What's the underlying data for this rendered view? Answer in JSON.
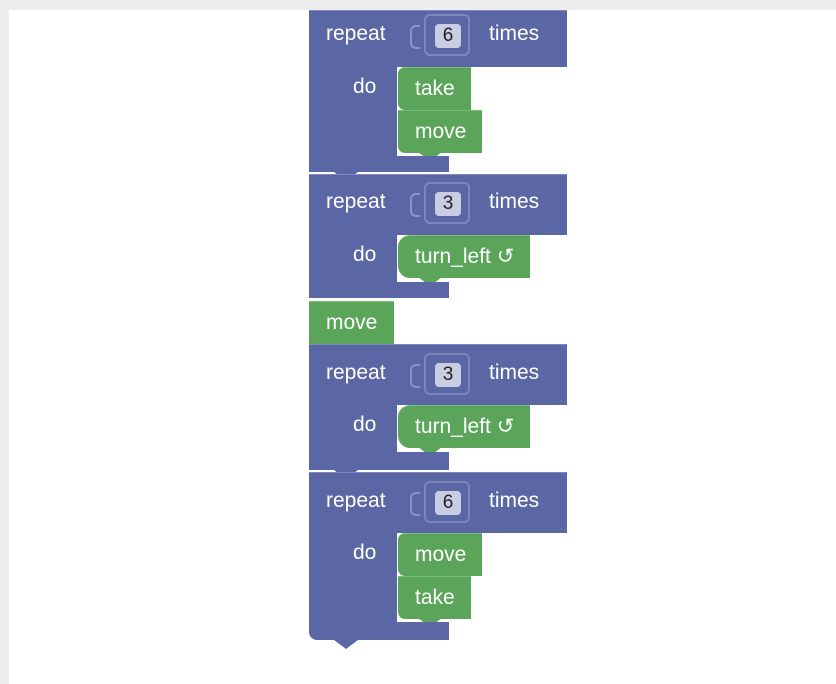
{
  "workspace": {
    "blocks": [
      {
        "type": "repeat",
        "keyword": "repeat",
        "count": "6",
        "suffix": "times",
        "do_label": "do",
        "body": [
          "take",
          "move"
        ]
      },
      {
        "type": "repeat",
        "keyword": "repeat",
        "count": "3",
        "suffix": "times",
        "do_label": "do",
        "body": [
          "turn_left ↺"
        ]
      },
      {
        "type": "action",
        "label": "move"
      },
      {
        "type": "repeat",
        "keyword": "repeat",
        "count": "3",
        "suffix": "times",
        "do_label": "do",
        "body": [
          "turn_left ↺"
        ]
      },
      {
        "type": "repeat",
        "keyword": "repeat",
        "count": "6",
        "suffix": "times",
        "do_label": "do",
        "body": [
          "move",
          "take"
        ]
      }
    ]
  },
  "colors": {
    "loop_block": "#5b67a5",
    "action_block": "#5ba55b",
    "workspace_bg": "#ffffff"
  }
}
